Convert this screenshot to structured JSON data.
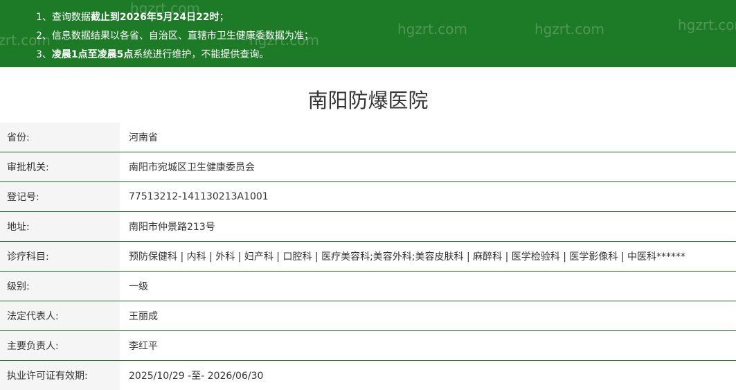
{
  "banner": {
    "notices": [
      {
        "prefix": "1、查询数据",
        "bold": "截止到2026年5月24日22时",
        "suffix": "；"
      },
      {
        "prefix": "2、信息数据结果以各省、自治区、直辖市卫生健康委数据为准；",
        "bold": "",
        "suffix": ""
      },
      {
        "prefix": "3、",
        "bold": "凌晨1点至凌晨5点",
        "suffix": "系统进行维护，不能提供查询。"
      }
    ],
    "watermark": "hgzrt.com",
    "background_color": "#1d7a26"
  },
  "hospital": {
    "name": "南阳防爆医院"
  },
  "info_rows": [
    {
      "label": "省份:",
      "value": "河南省"
    },
    {
      "label": "审批机关:",
      "value": "南阳市宛城区卫生健康委员会"
    },
    {
      "label": "登记号:",
      "value": "77513212-141130213A1001"
    },
    {
      "label": "地址:",
      "value": "南阳市仲景路213号"
    },
    {
      "label": "诊疗科目:",
      "value": "预防保健科 | 内科 | 外科 | 妇产科 | 口腔科 | 医疗美容科;美容外科;美容皮肤科 | 麻醉科 | 医学检验科 | 医学影像科 | 中医科******"
    },
    {
      "label": "级别:",
      "value": "一级"
    },
    {
      "label": "法定代表人:",
      "value": "王丽成"
    },
    {
      "label": "主要负责人:",
      "value": "李红平"
    },
    {
      "label": "执业许可证有效期:",
      "value": "2025/10/29 -至- 2026/06/30"
    }
  ]
}
